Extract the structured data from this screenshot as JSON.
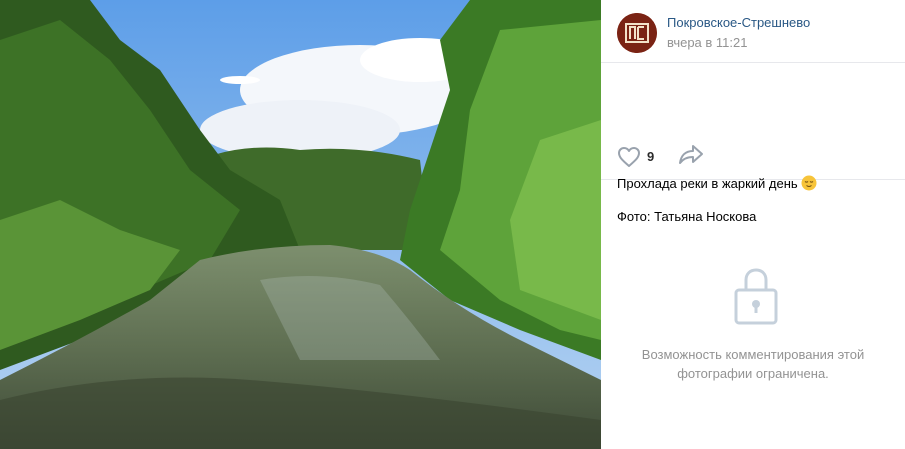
{
  "post": {
    "author": "Покровское-Стрешнево",
    "time": "вчера в 11:21",
    "likes": "9",
    "caption": "Прохлада реки в жаркий день",
    "credit": "Фото: Татьяна Носкова"
  },
  "comments": {
    "disabled_notice": "Возможность комментирования этой фотографии ограничена."
  },
  "icons": {
    "like": "heart-icon",
    "share": "share-arrow-icon",
    "lock": "lock-icon",
    "emoji": "relieved-face-emoji"
  },
  "colors": {
    "link": "#2a5885",
    "muted": "#939393",
    "icon": "#99a2ad",
    "lock": "#c5d0db"
  }
}
